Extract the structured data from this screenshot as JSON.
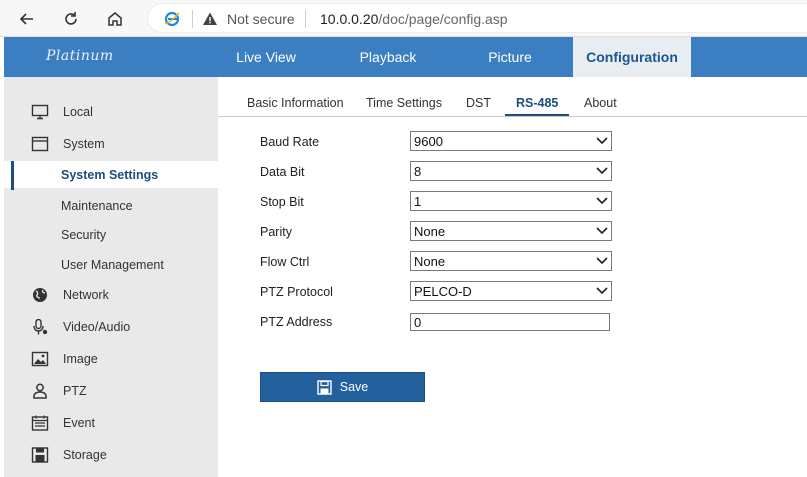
{
  "browser": {
    "security_label": "Not secure",
    "url_host": "10.0.0.20",
    "url_path": "/doc/page/config.asp"
  },
  "header": {
    "logo": "Platinum",
    "tabs": [
      {
        "label": "Live View"
      },
      {
        "label": "Playback"
      },
      {
        "label": "Picture"
      },
      {
        "label": "Configuration"
      }
    ],
    "active_tab": "Configuration",
    "accent_color": "#3b7ec1"
  },
  "sidebar": {
    "items": [
      {
        "label": "Local",
        "icon": "monitor-icon"
      },
      {
        "label": "System",
        "icon": "window-icon"
      },
      {
        "label": "System Settings",
        "sub": true,
        "active": true
      },
      {
        "label": "Maintenance",
        "sub": true
      },
      {
        "label": "Security",
        "sub": true
      },
      {
        "label": "User Management",
        "sub": true
      },
      {
        "label": "Network",
        "icon": "globe-icon"
      },
      {
        "label": "Video/Audio",
        "icon": "microphone-icon"
      },
      {
        "label": "Image",
        "icon": "picture-icon"
      },
      {
        "label": "PTZ",
        "icon": "person-icon"
      },
      {
        "label": "Event",
        "icon": "calendar-icon"
      },
      {
        "label": "Storage",
        "icon": "disk-icon"
      }
    ]
  },
  "subtabs": {
    "items": [
      {
        "label": "Basic Information"
      },
      {
        "label": "Time Settings"
      },
      {
        "label": "DST"
      },
      {
        "label": "RS-485"
      },
      {
        "label": "About"
      }
    ],
    "active": "RS-485"
  },
  "form": {
    "fields": [
      {
        "label": "Baud Rate",
        "value": "9600"
      },
      {
        "label": "Data Bit",
        "value": "8"
      },
      {
        "label": "Stop Bit",
        "value": "1"
      },
      {
        "label": "Parity",
        "value": "None"
      },
      {
        "label": "Flow Ctrl",
        "value": "None"
      },
      {
        "label": "PTZ Protocol",
        "value": "PELCO-D"
      },
      {
        "label": "PTZ Address",
        "value": "0"
      }
    ],
    "save_label": "Save"
  }
}
